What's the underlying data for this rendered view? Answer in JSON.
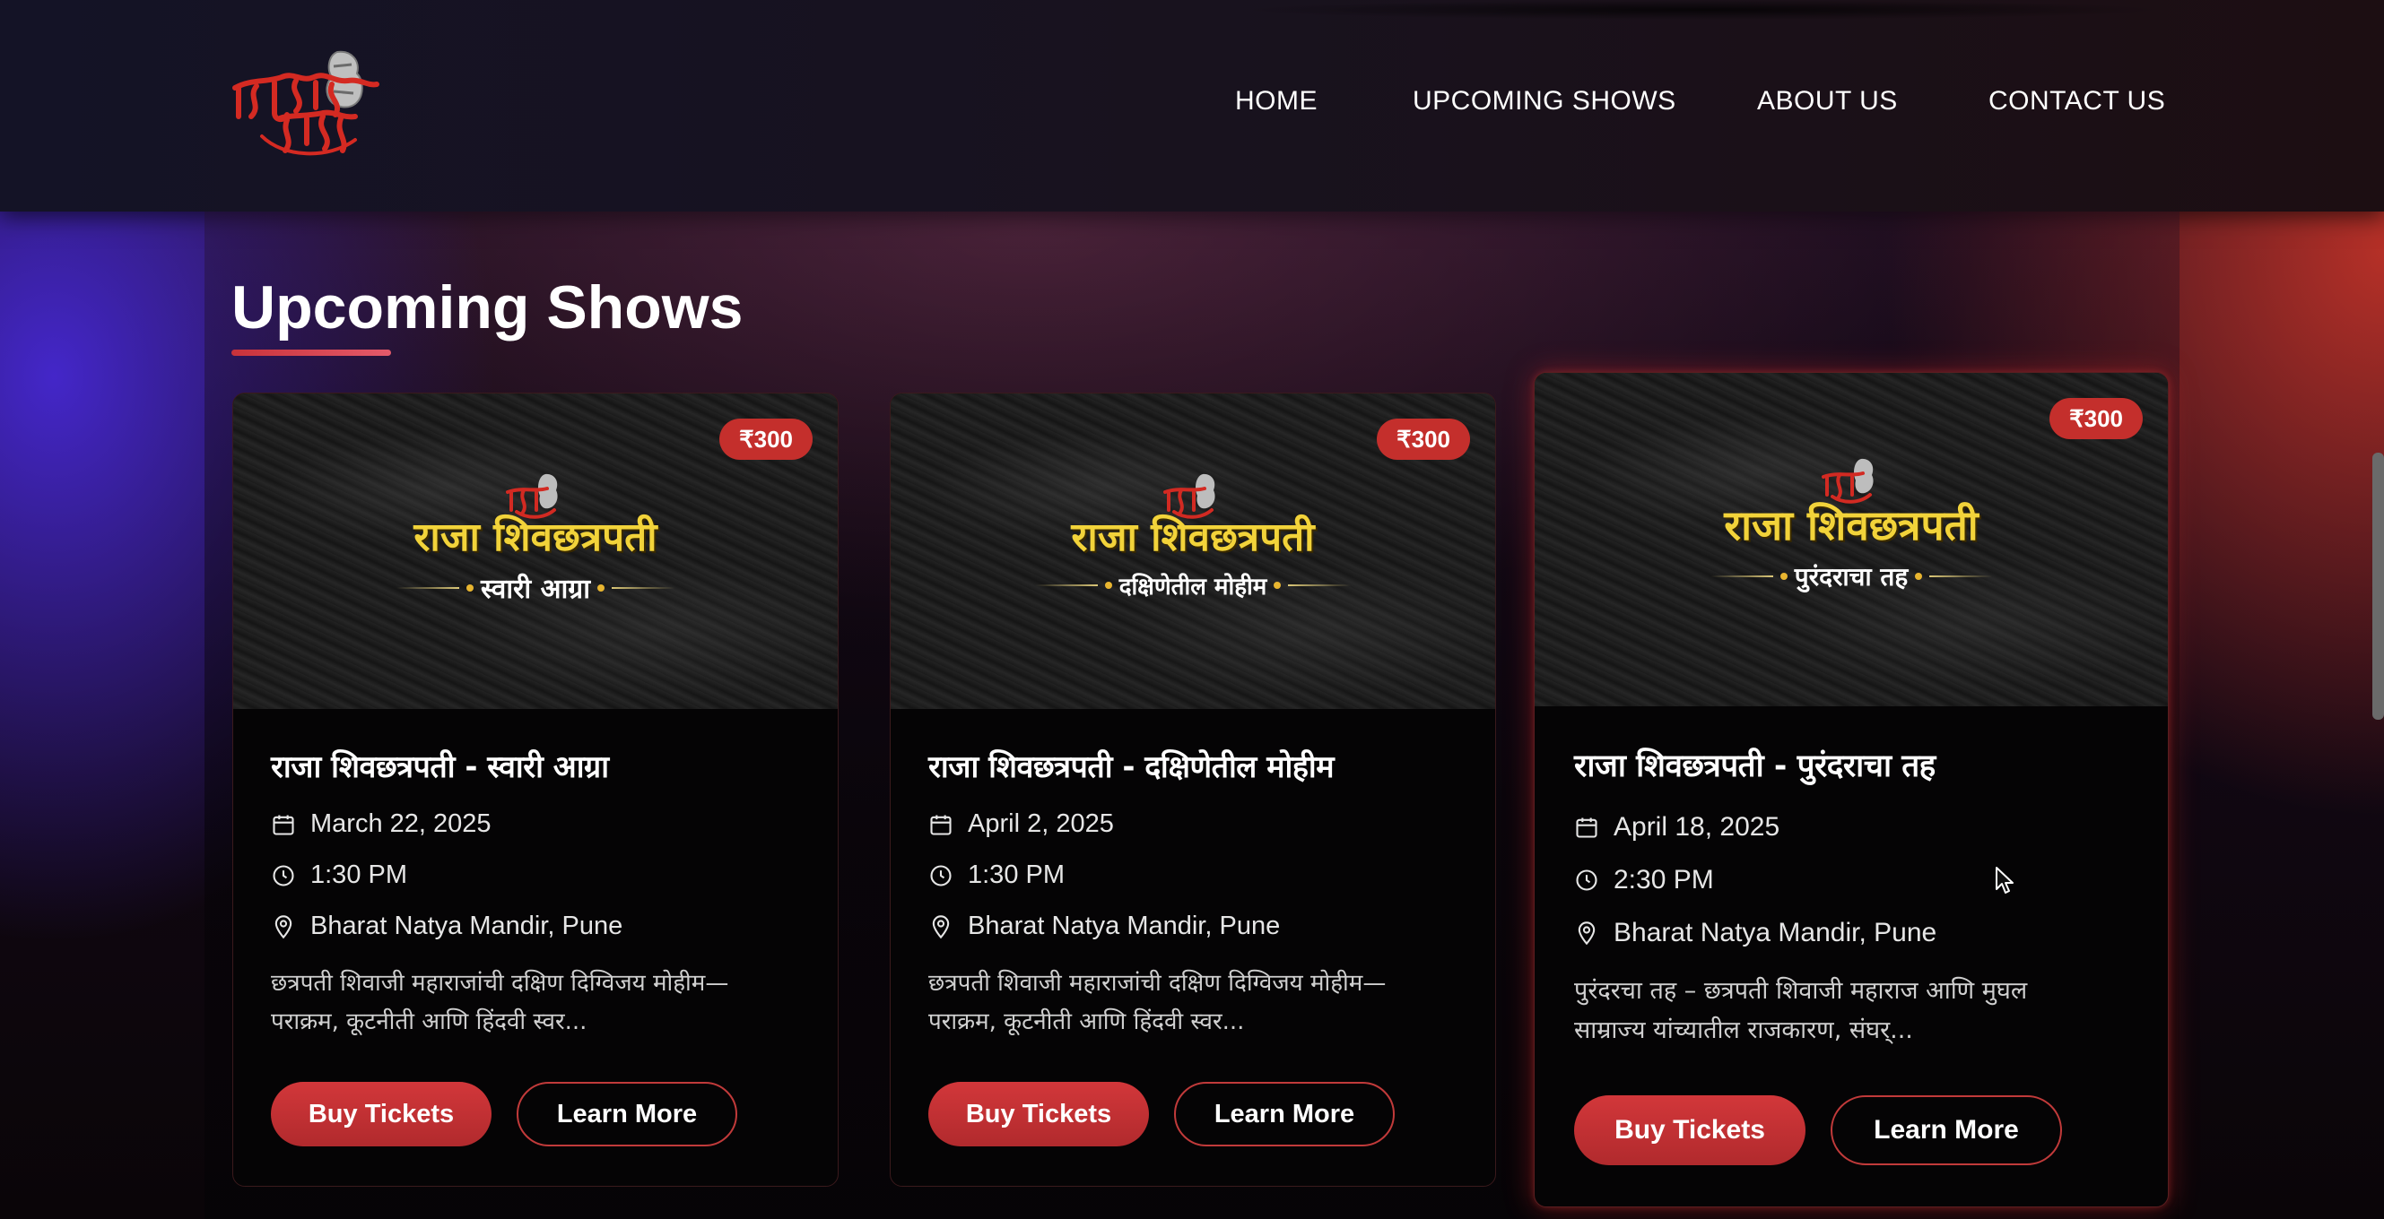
{
  "header": {
    "logo_text": "भैरवाचा भंडारा",
    "nav": [
      {
        "label": "HOME"
      },
      {
        "label": "UPCOMING SHOWS"
      },
      {
        "label": "ABOUT US"
      },
      {
        "label": "CONTACT US"
      }
    ]
  },
  "section": {
    "title": "Upcoming Shows"
  },
  "shows": [
    {
      "poster_title": "राजा शिवछत्रपती",
      "poster_subtitle": "स्वारी आग्रा",
      "price": "₹300",
      "title": "राजा शिवछत्रपती - स्वारी आग्रा",
      "date": "March 22, 2025",
      "time": "1:30 PM",
      "venue": "Bharat Natya Mandir, Pune",
      "desc_line1": "छत्रपती शिवाजी महाराजांची दक्षिण दिग्विजय मोहीम—",
      "desc_line2": "पराक्रम, कूटनीती आणि हिंदवी स्वर...",
      "buy_label": "Buy Tickets",
      "learn_label": "Learn More"
    },
    {
      "poster_title": "राजा शिवछत्रपती",
      "poster_subtitle": "दक्षिणेतील मोहीम",
      "price": "₹300",
      "title": "राजा शिवछत्रपती - दक्षिणेतील मोहीम",
      "date": "April 2, 2025",
      "time": "1:30 PM",
      "venue": "Bharat Natya Mandir, Pune",
      "desc_line1": "छत्रपती शिवाजी महाराजांची दक्षिण दिग्विजय मोहीम—",
      "desc_line2": "पराक्रम, कूटनीती आणि हिंदवी स्वर...",
      "buy_label": "Buy Tickets",
      "learn_label": "Learn More"
    },
    {
      "poster_title": "राजा शिवछत्रपती",
      "poster_subtitle": "पुरंदराचा तह",
      "price": "₹300",
      "title": "राजा शिवछत्रपती - पुरंदराचा तह",
      "date": "April 18, 2025",
      "time": "2:30 PM",
      "venue": "Bharat Natya Mandir, Pune",
      "desc_line1": "पुरंदरचा तह – छत्रपती शिवाजी महाराज आणि मुघल",
      "desc_line2": "साम्राज्य यांच्यातील राजकारण, संघर्...",
      "buy_label": "Buy Tickets",
      "learn_label": "Learn More"
    }
  ],
  "icons": {
    "date": "calendar-icon",
    "time": "clock-icon",
    "venue": "location-pin-icon"
  },
  "colors": {
    "accent": "#c42f2c",
    "poster_title": "#f2d33a",
    "background_blue": "#4628d2",
    "background_red": "#be3228"
  }
}
